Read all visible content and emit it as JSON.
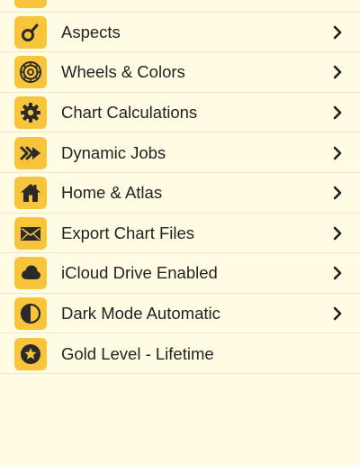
{
  "colors": {
    "background": "#fffce3",
    "icon_tile": "#f8c43b",
    "icon_glyph": "#2a2a2a",
    "separator": "#ece8cc",
    "text": "#222222"
  },
  "menu": {
    "items": [
      {
        "label": "",
        "icon": "partial-icon",
        "has_chevron": false
      },
      {
        "label": "Aspects",
        "icon": "aspects-icon",
        "has_chevron": true
      },
      {
        "label": "Wheels & Colors",
        "icon": "wheel-icon",
        "has_chevron": true
      },
      {
        "label": "Chart Calculations",
        "icon": "gear-icon",
        "has_chevron": true
      },
      {
        "label": "Dynamic Jobs",
        "icon": "fast-forward-icon",
        "has_chevron": true
      },
      {
        "label": "Home & Atlas",
        "icon": "home-icon",
        "has_chevron": true
      },
      {
        "label": "Export Chart Files",
        "icon": "envelope-icon",
        "has_chevron": true
      },
      {
        "label": "iCloud Drive Enabled",
        "icon": "cloud-icon",
        "has_chevron": true
      },
      {
        "label": "Dark Mode Automatic",
        "icon": "half-circle-icon",
        "has_chevron": true
      },
      {
        "label": "Gold Level - Lifetime",
        "icon": "star-badge-icon",
        "has_chevron": false
      }
    ]
  }
}
